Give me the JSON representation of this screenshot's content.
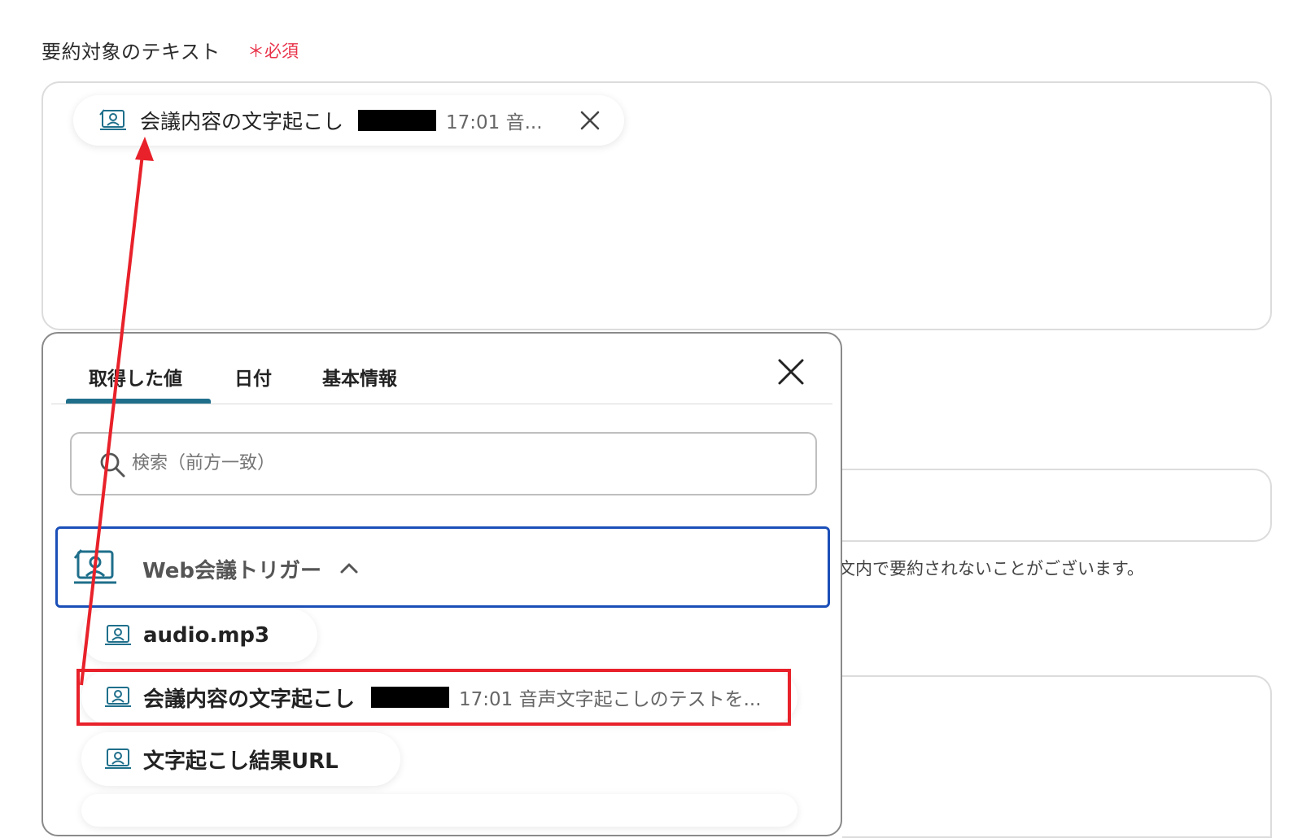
{
  "field": {
    "label": "要約対象のテキスト",
    "required_label": "＊必須",
    "chip": {
      "text": "会議内容の文字起こし",
      "meta": "17:01 音..."
    }
  },
  "background": {
    "note": "文内で要約されないことがございます。"
  },
  "picker": {
    "tabs": [
      "取得した値",
      "日付",
      "基本情報"
    ],
    "active_tab": "取得した値",
    "search_placeholder": "検索（前方一致）",
    "group": {
      "label": "Web会議トリガー",
      "expanded": true
    },
    "items": [
      {
        "label": "audio.mp3"
      },
      {
        "label": "会議内容の文字起こし",
        "meta": "17:01 音声文字起こしのテストを..."
      },
      {
        "label": "文字起こし結果URL"
      }
    ]
  },
  "colors": {
    "accent": "#1f6f8b",
    "group_border": "#1b4fb8",
    "annotation": "#e8212a",
    "required": "#e8334a"
  },
  "icons": {
    "chip_icon": "meeting-trigger-icon",
    "close": "close-icon",
    "search": "search-icon",
    "chevron": "chevron-up-icon"
  }
}
